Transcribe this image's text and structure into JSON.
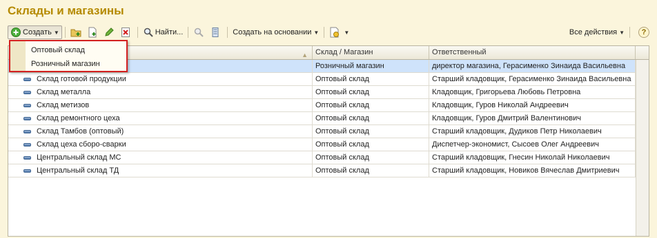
{
  "page": {
    "title": "Склады и магазины"
  },
  "toolbar": {
    "create_label": "Создать",
    "find_label": "Найти...",
    "create_based_on_label": "Создать на основании",
    "all_actions_label": "Все действия",
    "help_label": "?"
  },
  "dropdown": {
    "items": [
      {
        "label": "Оптовый склад"
      },
      {
        "label": "Розничный магазин"
      }
    ]
  },
  "table": {
    "columns": [
      "",
      "Склад / Магазин",
      "Ответственный"
    ],
    "rows": [
      {
        "name": "",
        "type": "Розничный магазин",
        "responsible": "директор магазина, Герасименко Зинаида Васильевна",
        "selected": true
      },
      {
        "name": "Склад готовой продукции",
        "type": "Оптовый склад",
        "responsible": "Старший кладовщик, Герасименко Зинаида Васильевна"
      },
      {
        "name": "Склад металла",
        "type": "Оптовый склад",
        "responsible": "Кладовщик, Григорьева Любовь Петровна"
      },
      {
        "name": "Склад метизов",
        "type": "Оптовый склад",
        "responsible": "Кладовщик, Гуров Николай Андреевич"
      },
      {
        "name": "Склад ремонтного цеха",
        "type": "Оптовый склад",
        "responsible": "Кладовщик, Гуров Дмитрий Валентинович"
      },
      {
        "name": "Склад Тамбов (оптовый)",
        "type": "Оптовый склад",
        "responsible": "Старший кладовщик, Дудиков Петр Николаевич"
      },
      {
        "name": "Склад цеха сборо-сварки",
        "type": "Оптовый склад",
        "responsible": "Диспетчер-экономист, Сысоев Олег Андреевич"
      },
      {
        "name": "Центральный склад МС",
        "type": "Оптовый склад",
        "responsible": "Старший кладовщик, Гнесин Николай Николаевич"
      },
      {
        "name": "Центральный склад ТД",
        "type": "Оптовый склад",
        "responsible": "Старший кладовщик, Новиков Вячеслав Дмитриевич"
      }
    ]
  }
}
